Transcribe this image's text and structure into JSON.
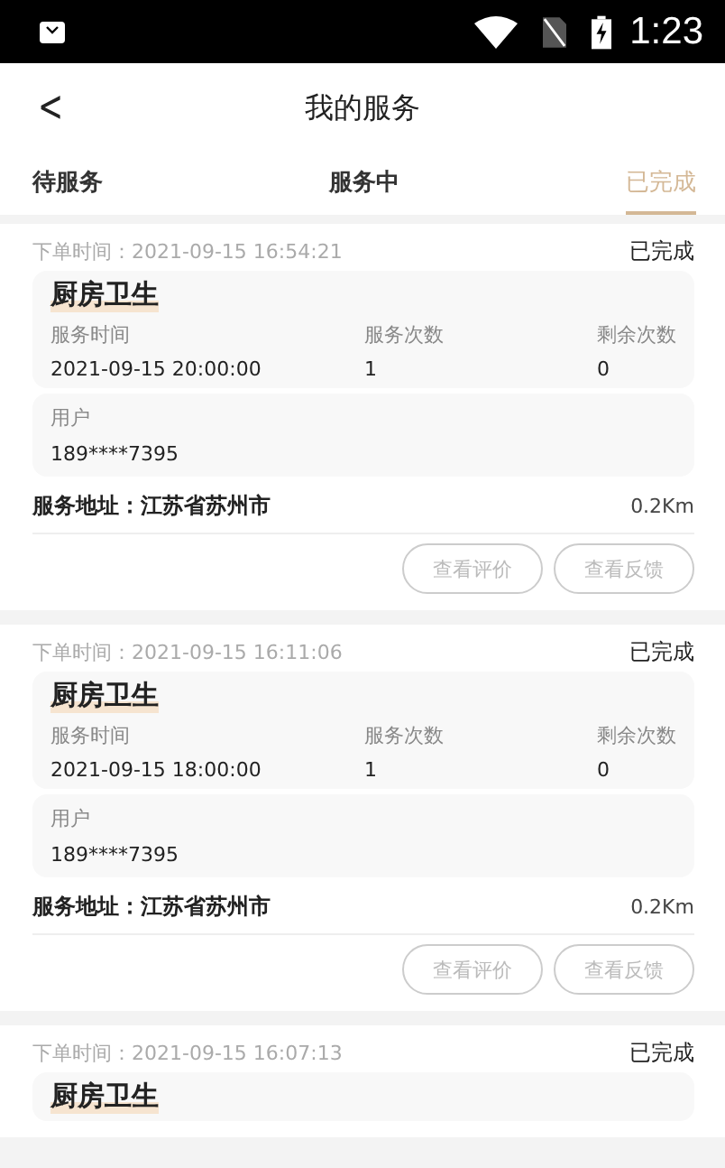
{
  "status_bar": {
    "time": "1:23"
  },
  "header": {
    "back": "<",
    "title": "我的服务"
  },
  "tabs": [
    {
      "label": "待服务",
      "selected": false
    },
    {
      "label": "服务中",
      "selected": false
    },
    {
      "label": "已完成",
      "selected": true
    }
  ],
  "orders": [
    {
      "order_time": "下单时间：2021-09-15 16:54:21",
      "status": "已完成",
      "service": "厨房卫生",
      "columns": [
        {
          "label": "服务时间",
          "value": "2021-09-15 20:00:00"
        },
        {
          "label": "服务次数",
          "value": "1"
        },
        {
          "label": "剩余次数",
          "value": "0"
        }
      ],
      "user_label": "用户",
      "user": "189****7395",
      "address": "服务地址：江苏省苏州市",
      "distance": "0.2Km",
      "buttons": [
        "查看评价",
        "查看反馈"
      ]
    },
    {
      "order_time": "下单时间：2021-09-15 16:11:06",
      "status": "已完成",
      "service": "厨房卫生",
      "columns": [
        {
          "label": "服务时间",
          "value": "2021-09-15 18:00:00"
        },
        {
          "label": "服务次数",
          "value": "1"
        },
        {
          "label": "剩余次数",
          "value": "0"
        }
      ],
      "user_label": "用户",
      "user": "189****7395",
      "address": "服务地址：江苏省苏州市",
      "distance": "0.2Km",
      "buttons": [
        "查看评价",
        "查看反馈"
      ]
    },
    {
      "order_time": "下单时间：2021-09-15 16:07:13",
      "status": "已完成",
      "service": "厨房卫生"
    }
  ]
}
